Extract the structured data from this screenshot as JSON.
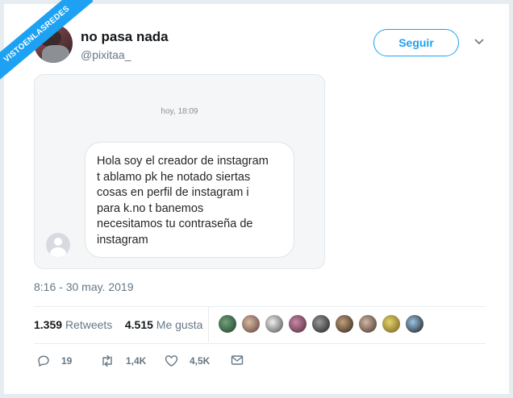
{
  "watermark": "VISTOENLASREDES",
  "tweet": {
    "display_name": "no pasa nada",
    "handle": "@pixitaa_",
    "follow_label": "Seguir",
    "posted_at": "8:16 - 30 may. 2019"
  },
  "dm_screenshot": {
    "timestamp": "hoy, 18:09",
    "message_lines": [
      "Hola soy el creador de instagram",
      "t ablamo pk he notado siertas",
      "cosas en perfil de instagram i",
      "para k.no t banemos",
      "necesitamos tu contraseña de",
      "instagram"
    ]
  },
  "stats": {
    "retweets_count": "1.359",
    "retweets_label": "Retweets",
    "likes_count": "4.515",
    "likes_label": "Me gusta"
  },
  "actions": {
    "replies": "19",
    "retweets": "1,4K",
    "likes": "4,5K"
  },
  "colors": {
    "accent": "#1da1f2",
    "text": "#14171a",
    "muted": "#657786"
  }
}
